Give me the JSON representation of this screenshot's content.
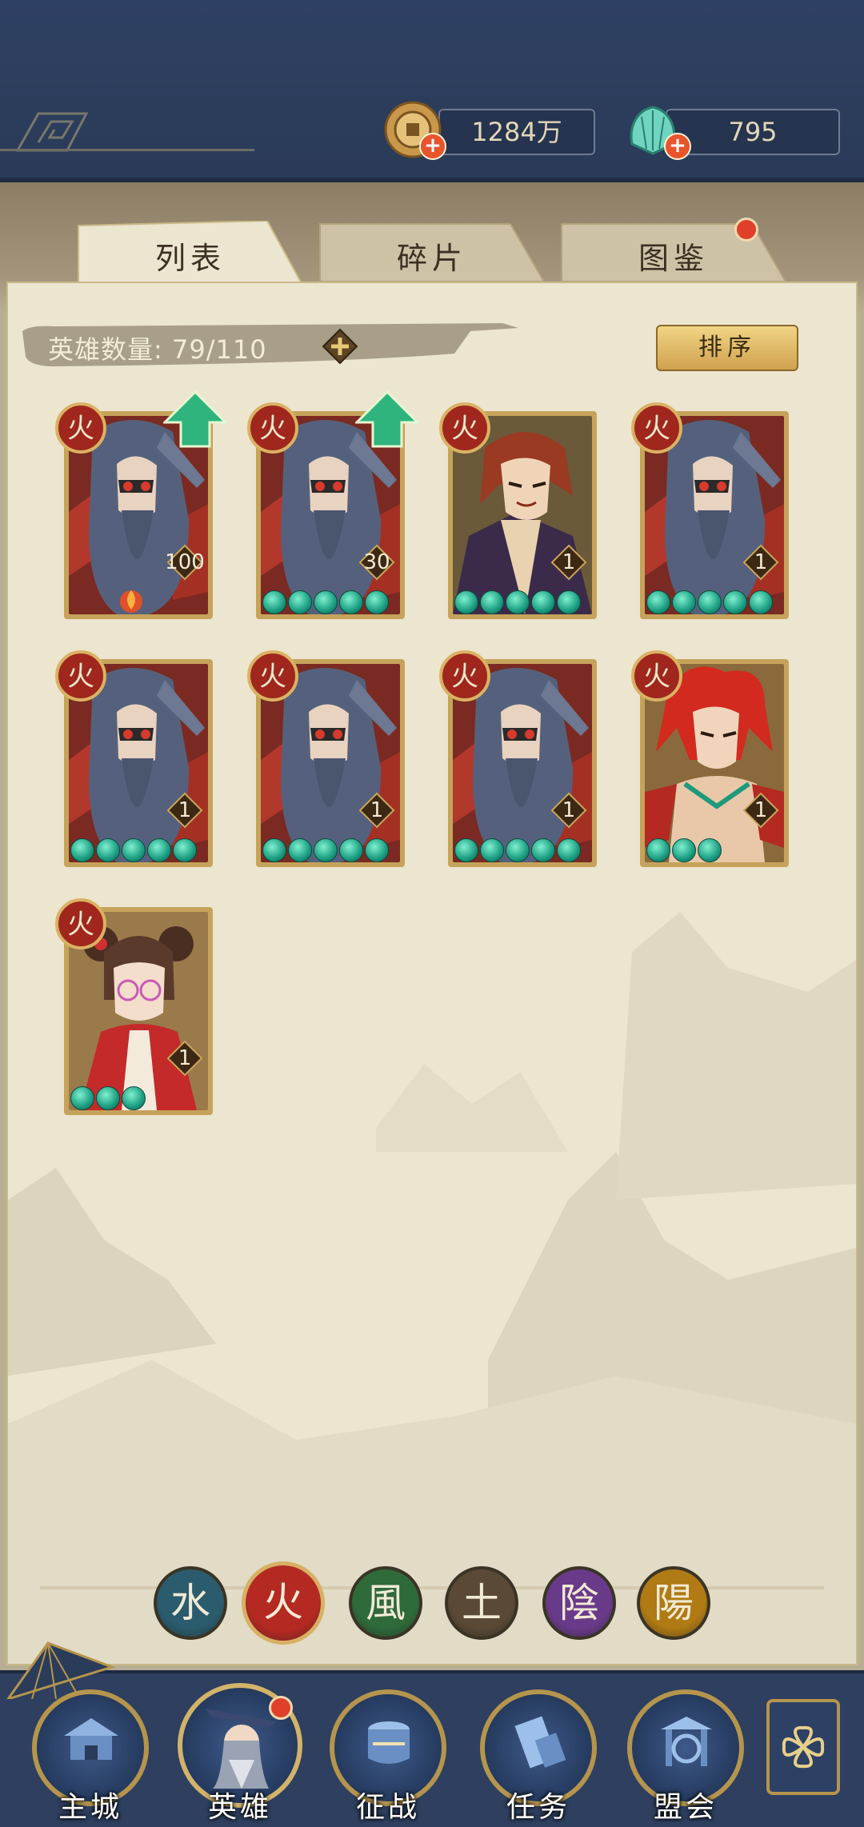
{
  "currency": {
    "coins": {
      "value": "1284万",
      "icon": "coin-icon"
    },
    "jade": {
      "value": "795",
      "icon": "jade-shell-icon"
    }
  },
  "tabs": [
    {
      "label": "列表",
      "active": true
    },
    {
      "label": "碎片",
      "active": false
    },
    {
      "label": "图鉴",
      "active": false,
      "badge": true
    }
  ],
  "hero_count": {
    "label": "英雄数量:",
    "value": "79/110"
  },
  "sort_button": "排序",
  "heroes": [
    {
      "level": "100",
      "stars": 0,
      "portrait": "masked-bearded-warrior",
      "upgrade": true,
      "flame": true
    },
    {
      "level": "30",
      "stars": 5,
      "portrait": "masked-bearded-warrior",
      "upgrade": true
    },
    {
      "level": "1",
      "stars": 5,
      "portrait": "red-haired-noble"
    },
    {
      "level": "1",
      "stars": 5,
      "portrait": "masked-bearded-warrior"
    },
    {
      "level": "1",
      "stars": 5,
      "portrait": "masked-bearded-warrior"
    },
    {
      "level": "1",
      "stars": 5,
      "portrait": "masked-bearded-warrior"
    },
    {
      "level": "1",
      "stars": 5,
      "portrait": "masked-bearded-warrior"
    },
    {
      "level": "1",
      "stars": 3,
      "portrait": "red-flame-haired-youth"
    },
    {
      "level": "1",
      "stars": 3,
      "portrait": "girl-in-red-dress"
    }
  ],
  "elements": [
    {
      "glyph": "水",
      "color": "#2b5c6e",
      "name": "water"
    },
    {
      "glyph": "火",
      "color": "#b42a22",
      "name": "fire",
      "active": true
    },
    {
      "glyph": "風",
      "color": "#2f6a3a",
      "name": "wind"
    },
    {
      "glyph": "土",
      "color": "#5a4a35",
      "name": "earth"
    },
    {
      "glyph": "陰",
      "color": "#6a3a8a",
      "name": "yin"
    },
    {
      "glyph": "陽",
      "color": "#b07a14",
      "name": "yang"
    }
  ],
  "nav": [
    {
      "label": "主城",
      "icon": "palace-icon"
    },
    {
      "label": "英雄",
      "icon": "hero-portrait-icon",
      "active": true,
      "badge": true
    },
    {
      "label": "征战",
      "icon": "war-drum-icon"
    },
    {
      "label": "任务",
      "icon": "scroll-icon"
    },
    {
      "label": "盟会",
      "icon": "gate-icon"
    }
  ],
  "accent": "#c6a35a"
}
